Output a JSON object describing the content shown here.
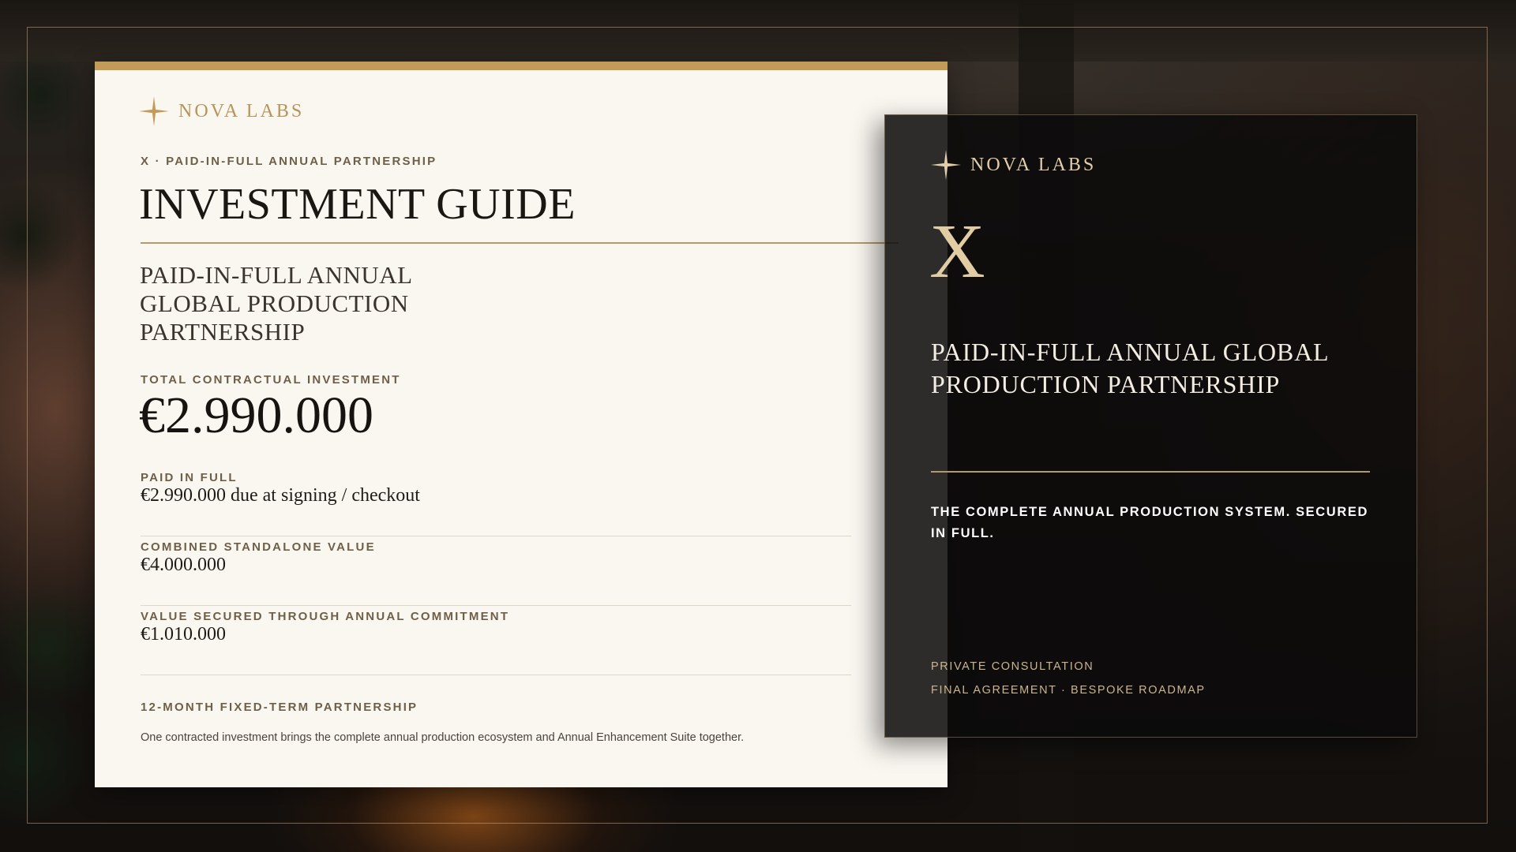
{
  "brand": {
    "name": "NOVA LABS"
  },
  "guide": {
    "eyebrow": "X · PAID-IN-FULL ANNUAL PARTNERSHIP",
    "title": "INVESTMENT GUIDE",
    "subtitle": "PAID-IN-FULL ANNUAL GLOBAL PRODUCTION PARTNERSHIP",
    "total_label": "TOTAL CONTRACTUAL INVESTMENT",
    "total_amount": "€2.990.000",
    "paid_label": "PAID IN FULL",
    "paid_value": "€2.990.000 due at signing / checkout",
    "standalone_label": "COMBINED STANDALONE VALUE",
    "standalone_value": "€4.000.000",
    "secured_label": "VALUE SECURED THROUGH ANNUAL COMMITMENT",
    "secured_value": "€1.010.000",
    "term_label": "12-MONTH FIXED-TERM PARTNERSHIP",
    "term_note": "One contracted investment brings the complete annual production ecosystem and Annual Enhancement Suite together."
  },
  "panel": {
    "letter": "X",
    "subtitle": "PAID-IN-FULL ANNUAL GLOBAL PRODUCTION PARTNERSHIP",
    "tagline": "THE COMPLETE ANNUAL PRODUCTION SYSTEM. SECURED IN FULL.",
    "footer_line1": "PRIVATE CONSULTATION",
    "footer_line2": "FINAL AGREEMENT · BESPOKE ROADMAP"
  },
  "colors": {
    "accent_gold": "#c29b59",
    "card_background": "#faf7f1",
    "panel_background": "#0c0b0a"
  }
}
